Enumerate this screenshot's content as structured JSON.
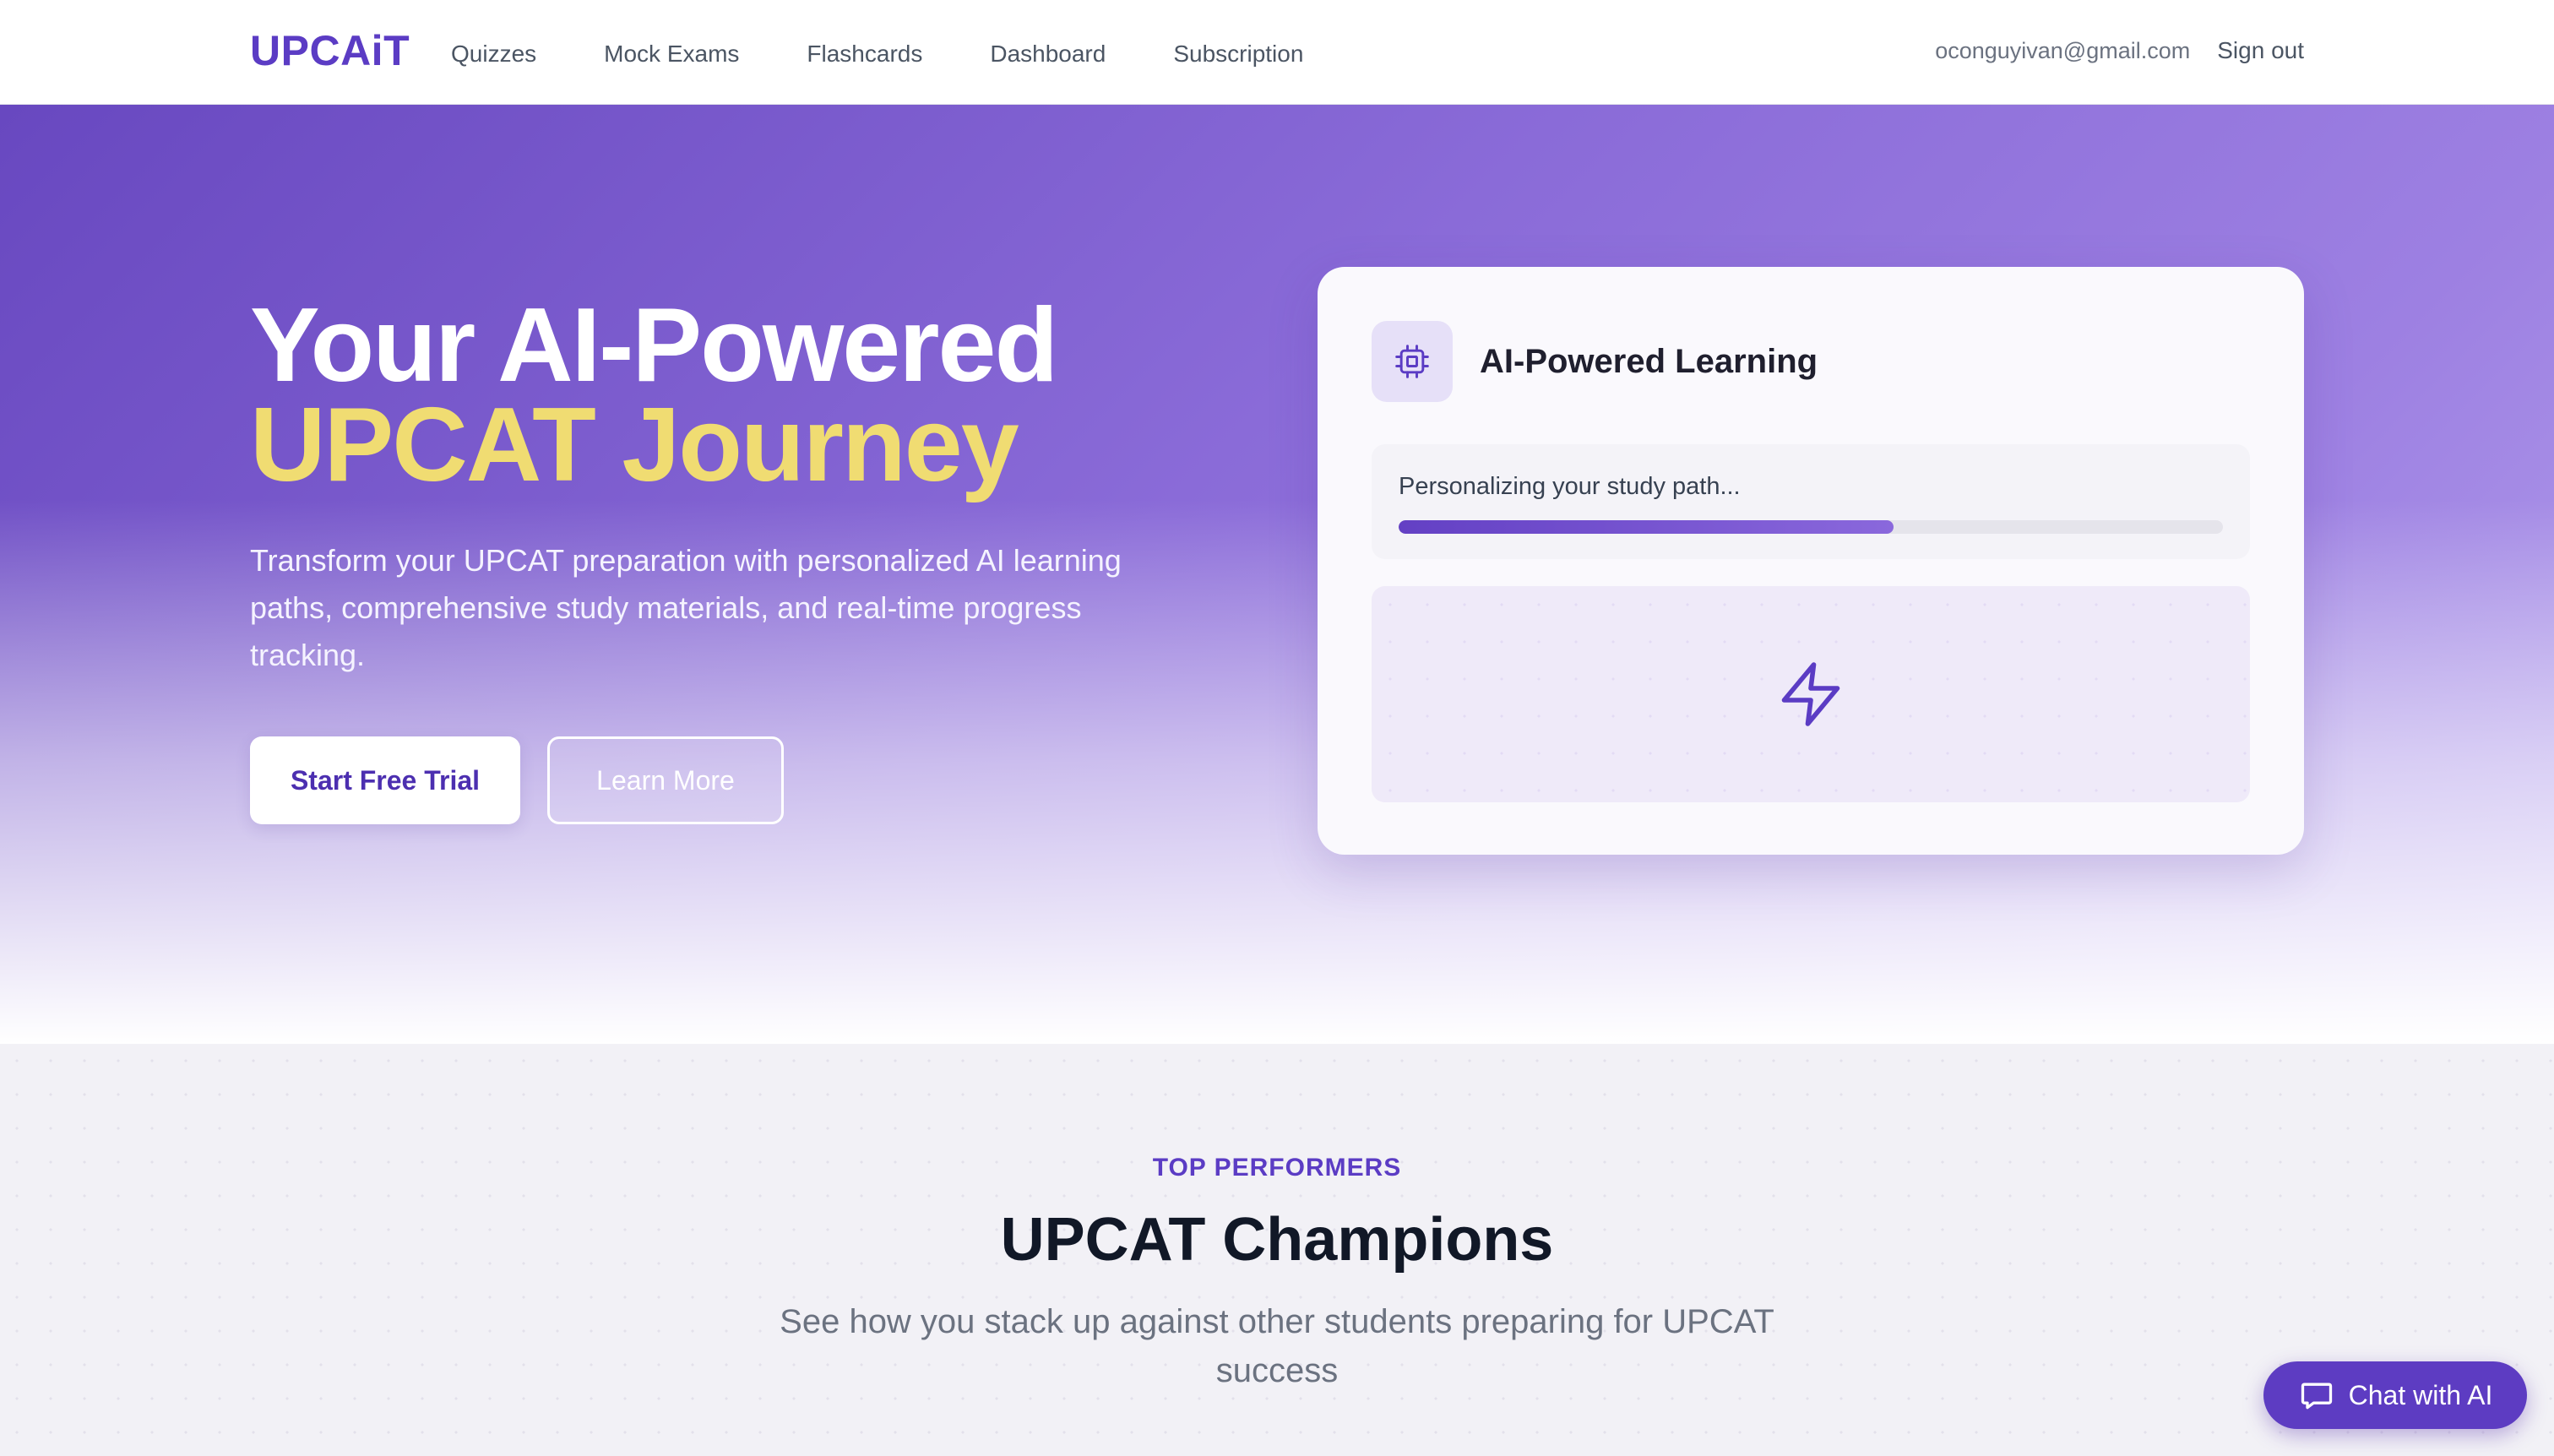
{
  "nav": {
    "logo": "UPCAiT",
    "links": [
      "Quizzes",
      "Mock Exams",
      "Flashcards",
      "Dashboard",
      "Subscription"
    ],
    "user_email": "oconguyivan@gmail.com",
    "signout_label": "Sign out"
  },
  "hero": {
    "title_line1": "Your AI-Powered",
    "title_line2": "UPCAT Journey",
    "subtitle": "Transform your UPCAT preparation with personalized AI learning paths, comprehensive study materials, and real-time progress tracking.",
    "primary_button": "Start Free Trial",
    "secondary_button": "Learn More"
  },
  "card": {
    "title": "AI-Powered Learning",
    "icon": "cpu-icon",
    "progress_text": "Personalizing your study path...",
    "progress_fraction": 0.6,
    "panel_icon": "lightning-bolt-icon"
  },
  "champions": {
    "eyebrow": "TOP PERFORMERS",
    "title": "UPCAT Champions",
    "subtitle": "See how you stack up against other students preparing for UPCAT success"
  },
  "chat": {
    "label": "Chat with AI",
    "icon": "chat-bubble-icon"
  },
  "colors": {
    "brand": "#5b3cc4",
    "accent_yellow": "#f0dc72",
    "chat_button": "#5d3cc2"
  }
}
